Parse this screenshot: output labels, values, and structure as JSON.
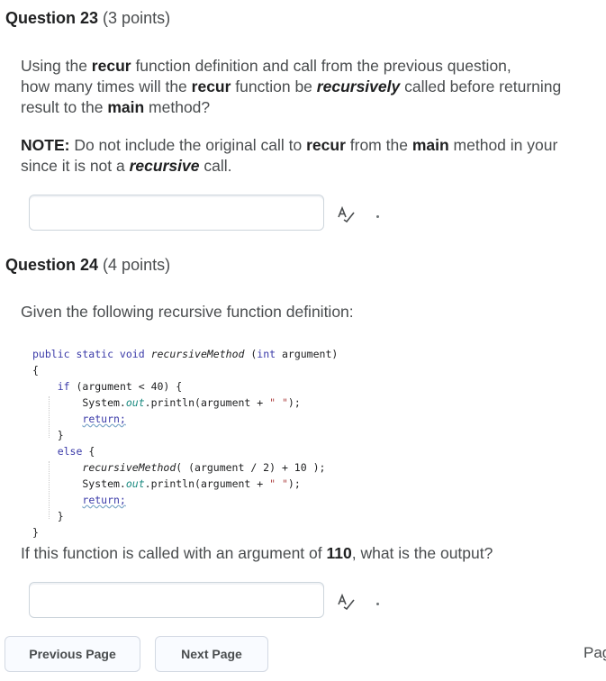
{
  "q23": {
    "title": "Question 23",
    "points": "(3 points)",
    "p1": [
      {
        "t": "Using the "
      },
      {
        "t": "recur",
        "b": 1
      },
      {
        "t": " function definition and call from the previous question,"
      },
      {
        "br": 1
      },
      {
        "t": "how many times will the "
      },
      {
        "t": "recur",
        "b": 1
      },
      {
        "t": " function be "
      },
      {
        "t": "recursively",
        "bi": 1
      },
      {
        "t": " called before returning"
      },
      {
        "br": 1
      },
      {
        "t": "result to the "
      },
      {
        "t": "main",
        "b": 1
      },
      {
        "t": " method?"
      }
    ],
    "p2": [
      {
        "t": "NOTE:",
        "b": 1
      },
      {
        "t": " Do not include the original call to "
      },
      {
        "t": "recur",
        "b": 1
      },
      {
        "t": " from the "
      },
      {
        "t": "main",
        "b": 1
      },
      {
        "t": " method in your"
      },
      {
        "br": 1
      },
      {
        "t": "since it is not a "
      },
      {
        "t": "recursive",
        "bi": 1
      },
      {
        "t": " call."
      }
    ],
    "answer_value": ""
  },
  "q24": {
    "title": "Question 24",
    "points": "(4 points)",
    "intro": "Given the following recursive function definition:",
    "code": [
      [
        {
          "t": "public static void ",
          "c": "kw"
        },
        {
          "t": "recursiveMethod",
          "c": "itl"
        },
        {
          "t": " ("
        },
        {
          "t": "int",
          "c": "kw"
        },
        {
          "t": " argument)"
        }
      ],
      [
        {
          "t": "{"
        }
      ],
      [
        {
          "t": "    "
        },
        {
          "t": "if",
          "c": "kw"
        },
        {
          "t": " (argument < 40) {"
        }
      ],
      [
        {
          "t": "        System."
        },
        {
          "t": "out",
          "c": "fld"
        },
        {
          "t": ".println(argument + "
        },
        {
          "t": "\" \"",
          "c": "str"
        },
        {
          "t": ");"
        }
      ],
      [
        {
          "t": "        "
        },
        {
          "t": "return;",
          "c": "und"
        }
      ],
      [
        {
          "t": "    }"
        }
      ],
      [
        {
          "t": "    "
        },
        {
          "t": "else",
          "c": "kw"
        },
        {
          "t": " {"
        }
      ],
      [
        {
          "t": "        "
        },
        {
          "t": "recursiveMethod",
          "c": "itl"
        },
        {
          "t": "( (argument / 2) + 10 );"
        }
      ],
      [
        {
          "t": "        System."
        },
        {
          "t": "out",
          "c": "fld"
        },
        {
          "t": ".println(argument + "
        },
        {
          "t": "\" \"",
          "c": "str"
        },
        {
          "t": ");"
        }
      ],
      [
        {
          "t": "        "
        },
        {
          "t": "return;",
          "c": "und"
        }
      ],
      [
        {
          "t": "    }"
        }
      ],
      [
        {
          "t": "}"
        }
      ]
    ],
    "question": [
      {
        "t": "If this function is called with an argument of "
      },
      {
        "t": "110",
        "b": 1
      },
      {
        "t": ", what is the output?"
      }
    ],
    "answer_value": ""
  },
  "nav": {
    "prev_label": "Previous Page",
    "next_label": "Next Page",
    "page_label": "Page"
  },
  "icons": {
    "spellcheck": "spellcheck-icon"
  }
}
